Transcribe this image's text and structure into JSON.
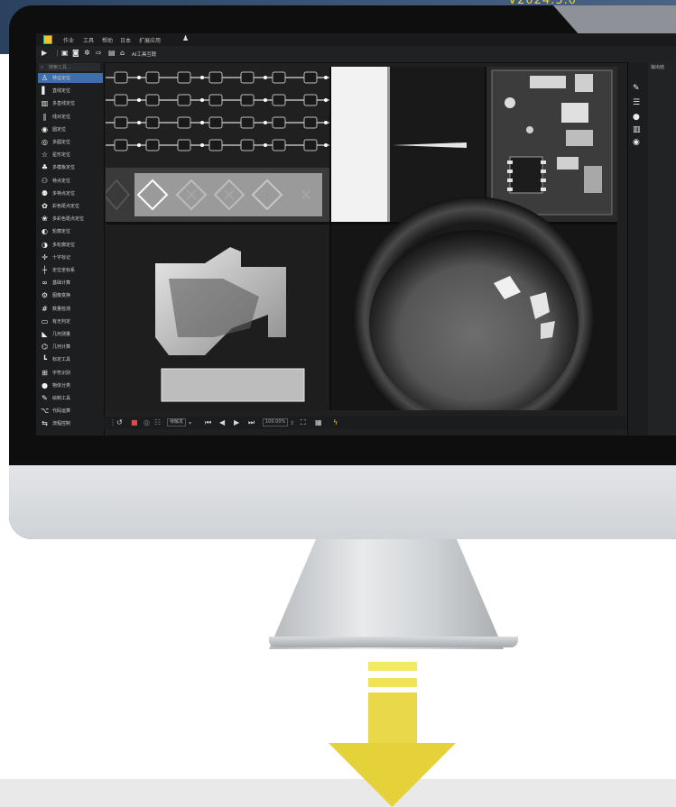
{
  "banner": {
    "version": "V2024.3.0"
  },
  "menu": [
    "作业",
    "工具",
    "帮助",
    "日本",
    "扩展应用"
  ],
  "toolbar": {
    "ai_label": "AI工具互联"
  },
  "sidebar": {
    "search_placeholder": "搜索工具...",
    "items": [
      {
        "label": "特征定位",
        "icon": "person-pin-icon",
        "active": true
      },
      {
        "label": "直线定位",
        "icon": "line-icon"
      },
      {
        "label": "多直线定位",
        "icon": "multi-line-icon"
      },
      {
        "label": "线对定位",
        "icon": "line-pair-icon"
      },
      {
        "label": "圆定位",
        "icon": "circle-icon"
      },
      {
        "label": "多圆定位",
        "icon": "multi-circle-icon"
      },
      {
        "label": "星形定位",
        "icon": "star-icon"
      },
      {
        "label": "多模板定位",
        "icon": "multi-template-icon"
      },
      {
        "label": "特点定位",
        "icon": "point-icon"
      },
      {
        "label": "多特点定位",
        "icon": "multi-point-icon"
      },
      {
        "label": "彩色斑点定位",
        "icon": "color-blob-icon"
      },
      {
        "label": "多彩色斑点定位",
        "icon": "multi-color-blob-icon"
      },
      {
        "label": "轮廓定位",
        "icon": "contour-icon"
      },
      {
        "label": "多轮廓定位",
        "icon": "multi-contour-icon"
      },
      {
        "label": "十字标记",
        "icon": "crosshair-icon"
      },
      {
        "label": "定位坐标系",
        "icon": "coordinate-icon"
      },
      {
        "label": "基础计算",
        "icon": "infinity-icon"
      },
      {
        "label": "图像变换",
        "icon": "transform-icon"
      },
      {
        "label": "数量检测",
        "icon": "count-icon"
      },
      {
        "label": "有无判定",
        "icon": "presence-icon"
      },
      {
        "label": "几何测量",
        "icon": "geometry-icon"
      },
      {
        "label": "几何计算",
        "icon": "geometry-calc-icon"
      },
      {
        "label": "标定工具",
        "icon": "calibration-icon"
      },
      {
        "label": "字符识别",
        "icon": "ocr-icon"
      },
      {
        "label": "物体分类",
        "icon": "classify-icon"
      },
      {
        "label": "绘制工具",
        "icon": "draw-icon"
      },
      {
        "label": "代码运算",
        "icon": "code-icon"
      },
      {
        "label": "流程控制",
        "icon": "flow-icon"
      }
    ]
  },
  "statusbar": {
    "mode": "待触发",
    "zoom": "100.00%"
  },
  "right_panel": {
    "header": "输出结"
  }
}
